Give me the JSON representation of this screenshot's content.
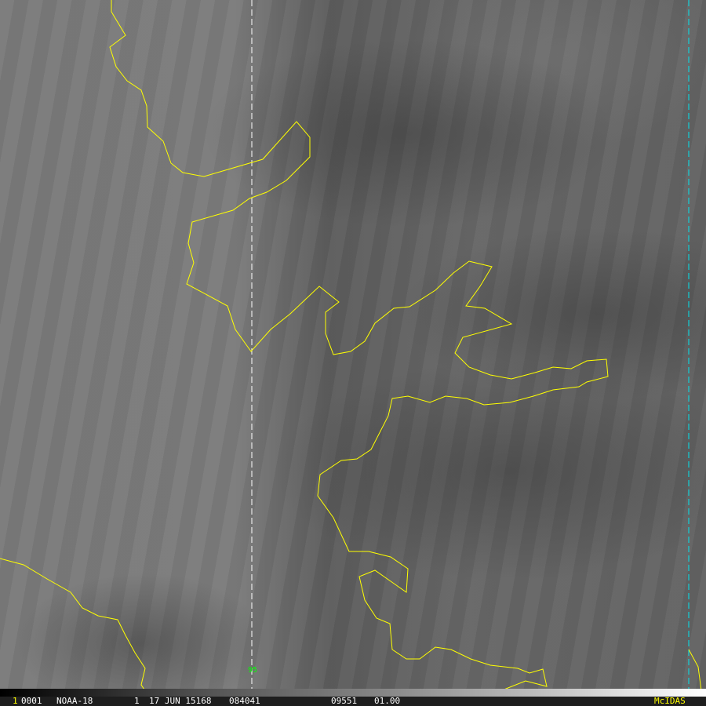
{
  "image": {
    "frame_number": "1",
    "frame_id": "0001",
    "satellite": "NOAA-18",
    "band": "1",
    "date": "17 JUN 15168",
    "time": "084041",
    "center_id": "09551",
    "magnification": "01.00",
    "brand": "McIDAS",
    "grid_label": "95"
  },
  "colors": {
    "coastline": "#ffff00",
    "meridian_dashed": "#ffffff",
    "edge_dashed": "#00e5ee",
    "grid_label": "#00ff00"
  }
}
